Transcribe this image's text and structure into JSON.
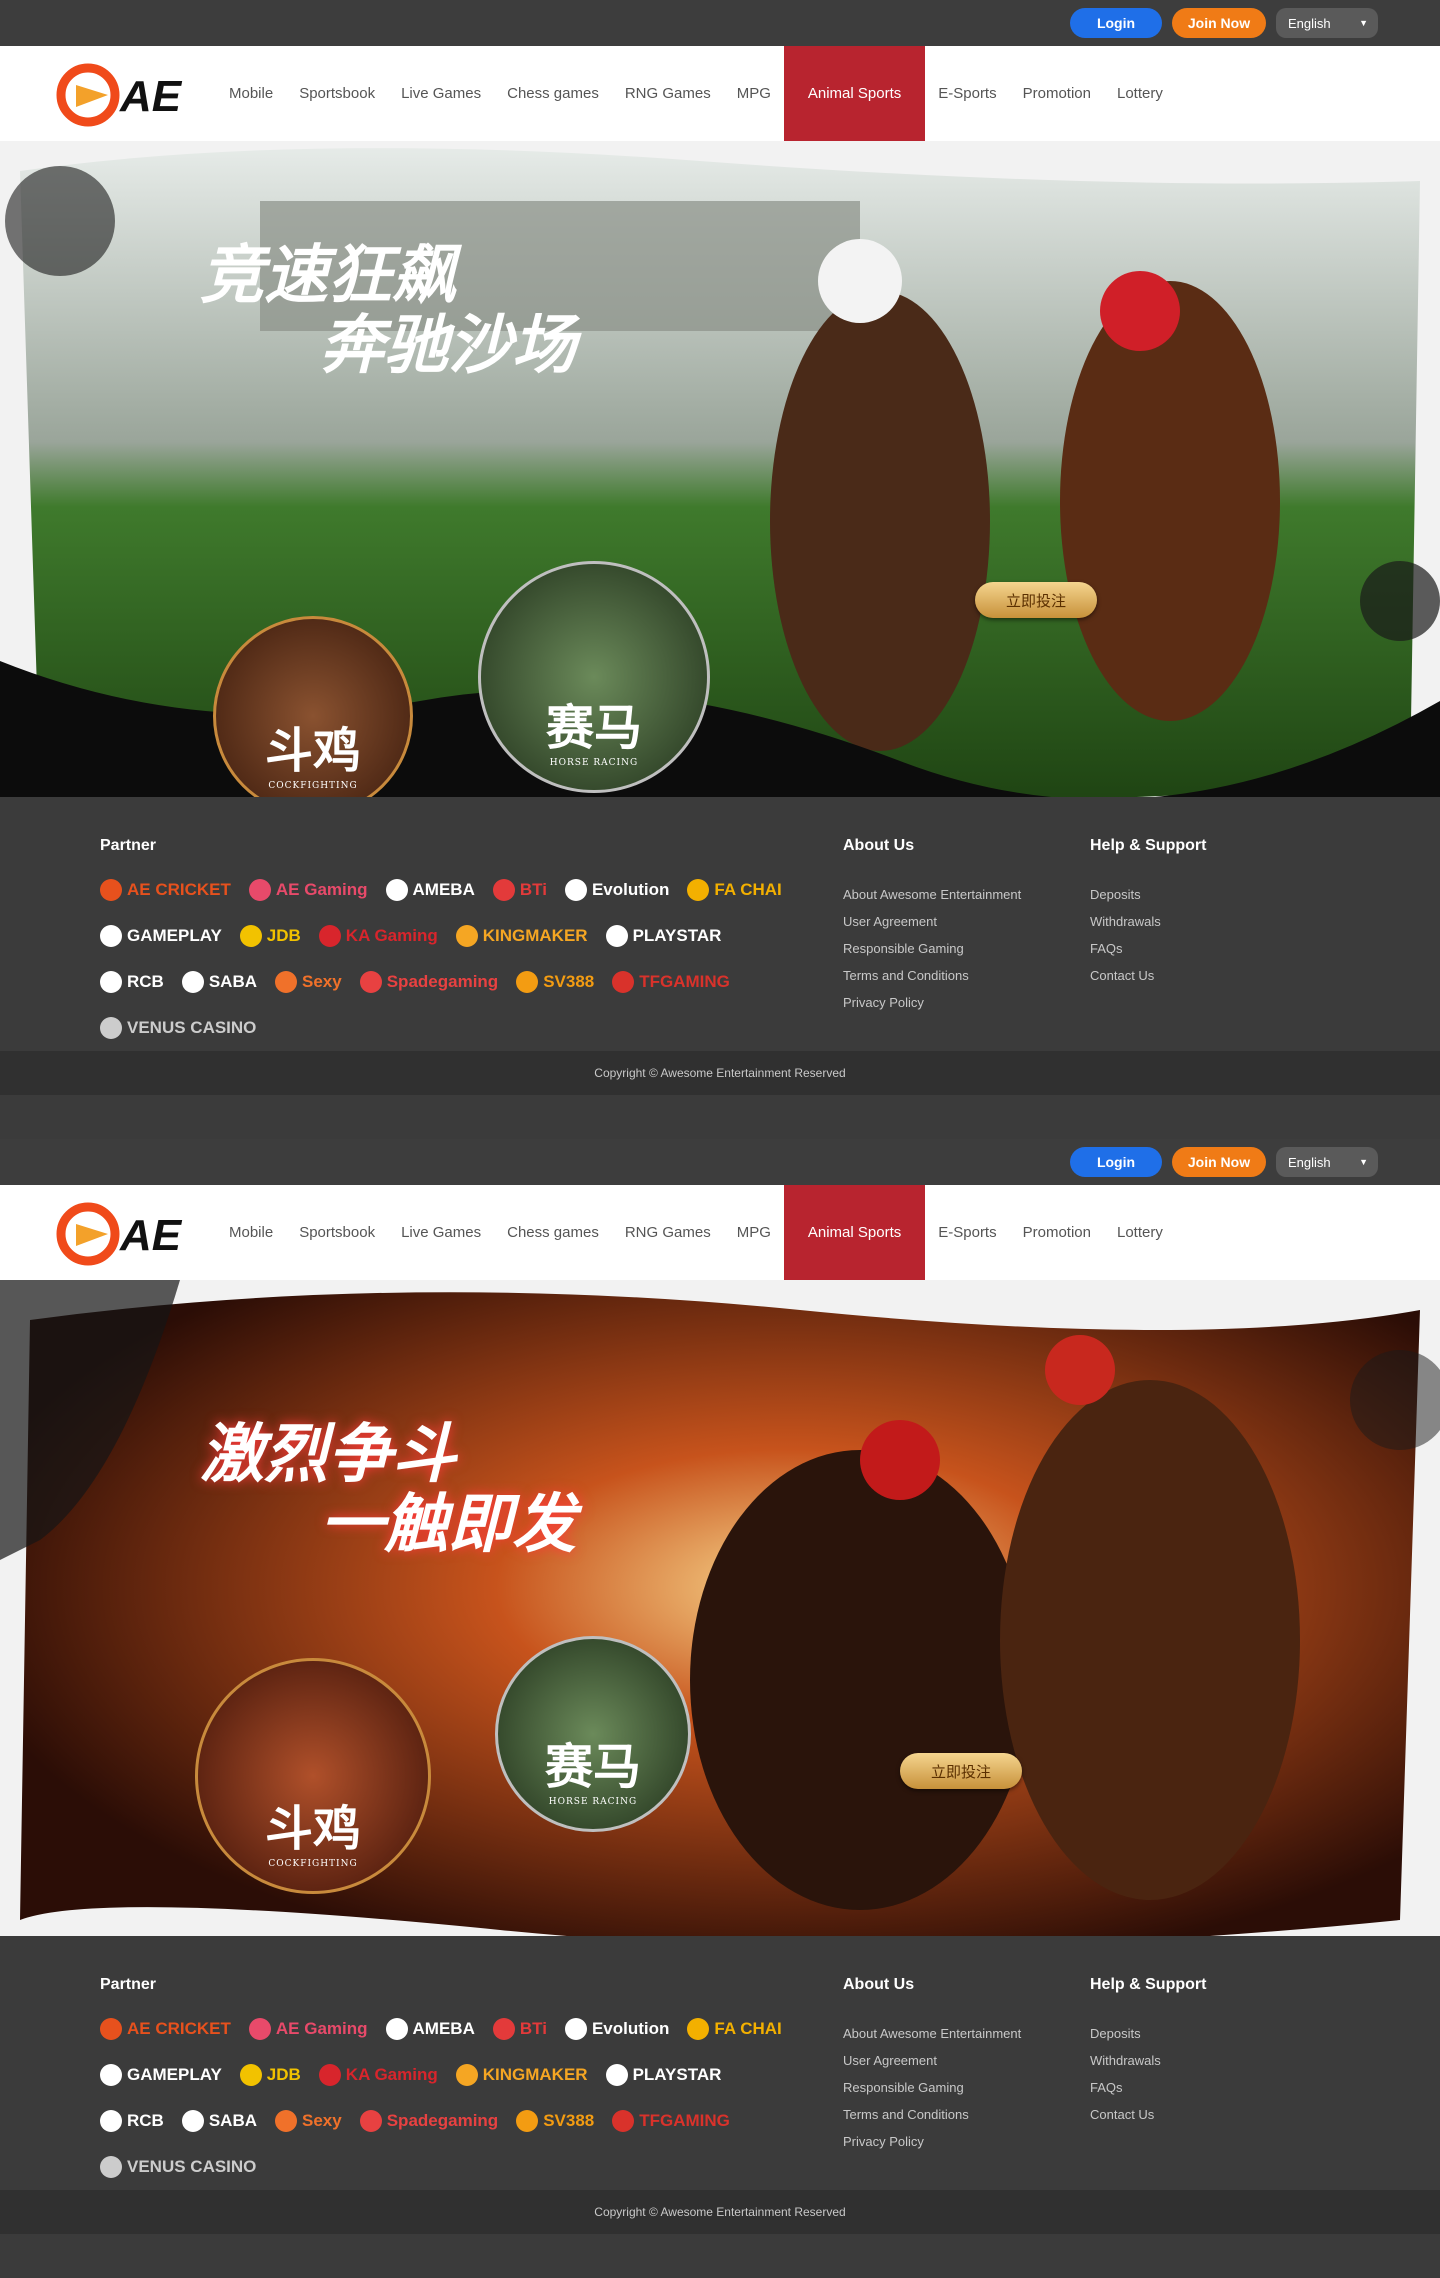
{
  "topbar": {
    "login": "Login",
    "join": "Join Now",
    "language": "English"
  },
  "nav": {
    "items": [
      "Mobile",
      "Sportsbook",
      "Live Games",
      "Chess games",
      "RNG Games",
      "MPG",
      "Animal Sports",
      "E-Sports",
      "Promotion",
      "Lottery"
    ],
    "active": "Animal Sports"
  },
  "logo_text": "AE",
  "screens": [
    {
      "slogan_line1": "竞速狂飙",
      "slogan_line2": "奔驰沙场",
      "badge_cock": "斗鸡",
      "badge_cock_sub": "COCKFIGHTING",
      "badge_horse": "赛马",
      "badge_horse_sub": "HORSE RACING",
      "bet": "立即投注"
    },
    {
      "slogan_line1": "激烈争斗",
      "slogan_line2": "一触即发",
      "badge_cock": "斗鸡",
      "badge_cock_sub": "COCKFIGHTING",
      "badge_horse": "赛马",
      "badge_horse_sub": "HORSE RACING",
      "bet": "立即投注"
    }
  ],
  "footer": {
    "partner_title": "Partner",
    "partners": [
      "AE CRICKET",
      "AE Gaming",
      "AMEBA",
      "BTi",
      "Evolution",
      "FA CHAI",
      "GAMEPLAY",
      "JDB",
      "KA Gaming",
      "KINGMAKER",
      "PLAYSTAR",
      "RCB",
      "SABA",
      "Sexy",
      "Spadegaming",
      "SV388",
      "TFGAMING",
      "VENUS CASINO"
    ],
    "about_title": "About Us",
    "about_links": [
      "About Awesome Entertainment",
      "User Agreement",
      "Responsible Gaming",
      "Terms and Conditions",
      "Privacy Policy"
    ],
    "help_title": "Help & Support",
    "help_links": [
      "Deposits",
      "Withdrawals",
      "FAQs",
      "Contact Us"
    ],
    "copyright": "Copyright © Awesome Entertainment Reserved"
  },
  "colors": {
    "active_nav": "#b8242f",
    "login": "#1f6fe8",
    "join": "#f07b16",
    "footer_bg": "#3b3b3b"
  }
}
